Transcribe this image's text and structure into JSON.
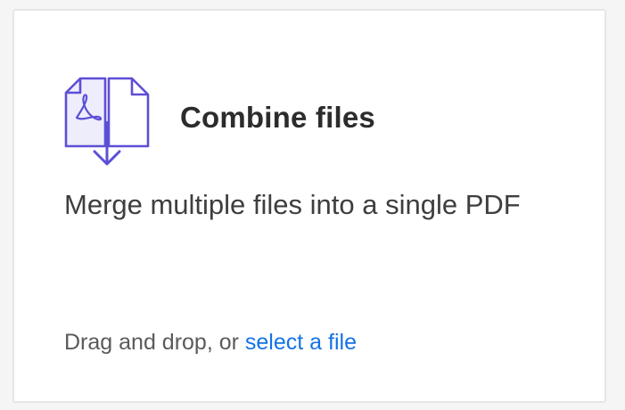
{
  "card": {
    "icon": "combine-files-icon",
    "title": "Combine files",
    "description": "Merge multiple files into a single PDF",
    "drop_prefix": "Drag and drop, or ",
    "select_link": "select a file"
  },
  "colors": {
    "accent": "#1473e6",
    "icon": "#5c4fd6"
  }
}
